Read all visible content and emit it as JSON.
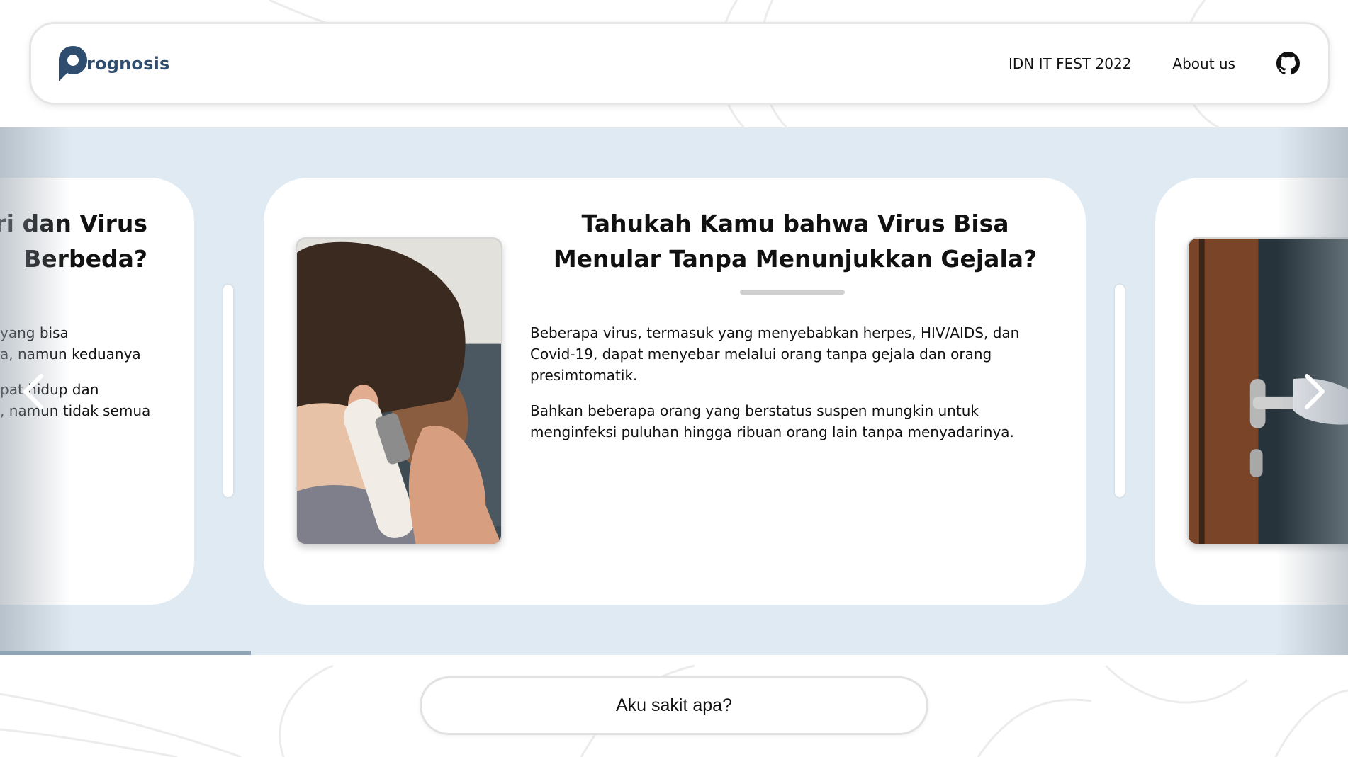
{
  "header": {
    "logo_text": "rognosis",
    "nav": {
      "event_link": "IDN IT FEST 2022",
      "about_link": "About us"
    },
    "github_icon": "github-icon"
  },
  "carousel": {
    "progress": 0.186,
    "prev_card": {
      "title_line1": "eri dan Virus",
      "title_line2": "Berbeda?",
      "para1_line1": "yang bisa",
      "para1_line2": "a, namun keduanya",
      "para2_line1": "pat hidup dan",
      "para2_line2": ", namun tidak semua"
    },
    "active_card": {
      "title": "Tahukah Kamu bahwa Virus Bisa Menular Tanpa Menunjukkan Gejala?",
      "paragraph1": "Beberapa virus, termasuk yang menyebabkan herpes, HIV/AIDS, dan Covid-19, dapat menyebar melalui orang tanpa gejala dan orang presimtomatik.",
      "paragraph2": "Bahkan beberapa orang yang berstatus suspen mungkin untuk menginfeksi puluhan hingga ribuan orang lain tanpa menyadarinya.",
      "image": "thermometer-ear-photo"
    },
    "next_card": {
      "image": "door-handle-photo"
    },
    "prev_icon": "chevron-left-icon",
    "next_icon": "chevron-right-icon"
  },
  "cta": {
    "label": "Aku sakit apa?"
  },
  "colors": {
    "brand": "#2f4d6e",
    "carousel_bg": "#dfeaf3",
    "progress": "#8fa4b6"
  }
}
